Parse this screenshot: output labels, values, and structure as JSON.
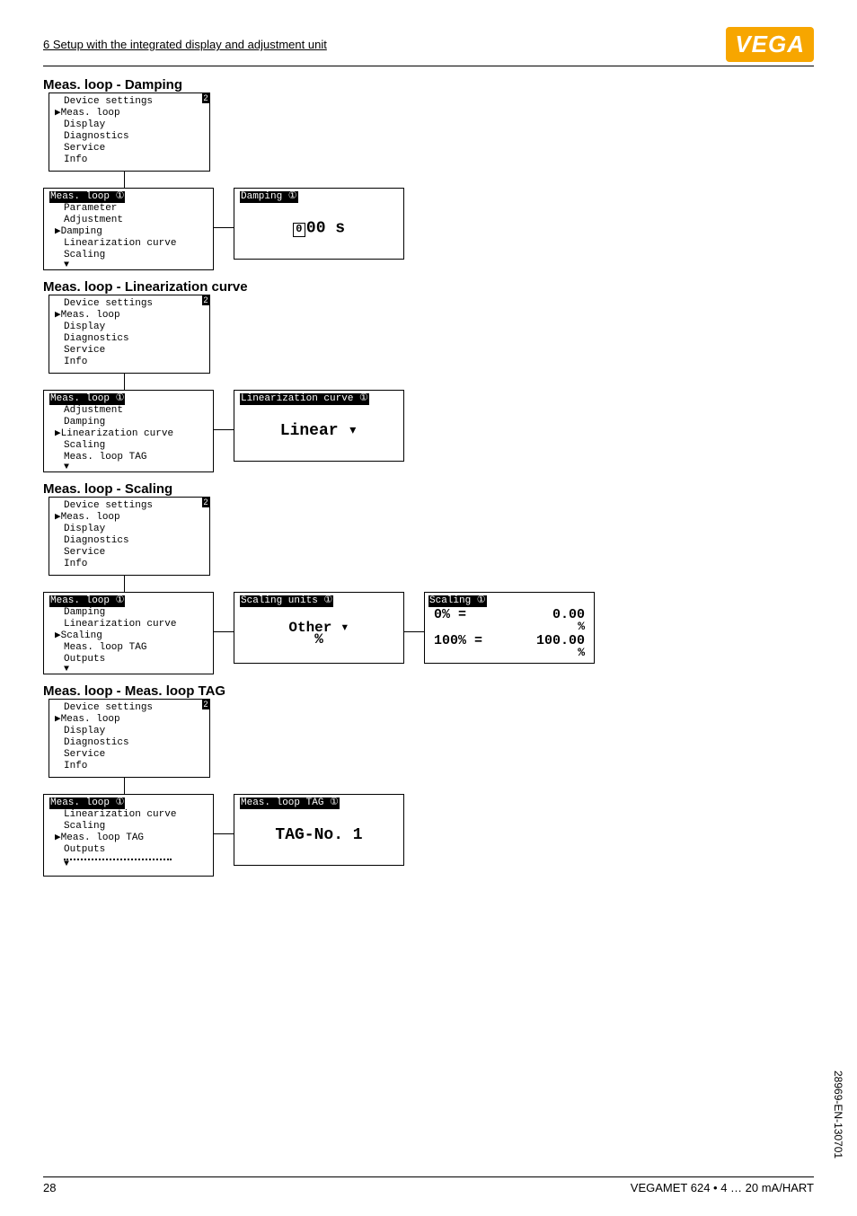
{
  "header": {
    "section_path": "6 Setup with the integrated display and adjustment unit",
    "logo": "VEGA"
  },
  "sections": {
    "damping": {
      "title": "Meas. loop - Damping",
      "top_menu": [
        "Device settings",
        "▶Meas. loop",
        "Display",
        "Diagnostics",
        "Service",
        "Info"
      ],
      "left": {
        "header": "Meas. loop ①",
        "items": [
          "Parameter",
          "Adjustment",
          "▶Damping",
          "Linearization curve",
          "Scaling"
        ]
      },
      "right": {
        "header": "Damping ①",
        "value_prefix": "0",
        "value_suffix": "00 s"
      }
    },
    "lin": {
      "title": "Meas. loop - Linearization curve",
      "top_menu": [
        "Device settings",
        "▶Meas. loop",
        "Display",
        "Diagnostics",
        "Service",
        "Info"
      ],
      "left": {
        "header": "Meas. loop ①",
        "items": [
          "Adjustment",
          "Damping",
          "▶Linearization curve",
          "Scaling",
          "Meas. loop TAG"
        ]
      },
      "right": {
        "header": "Linearization curve ①",
        "value": "Linear ▾"
      }
    },
    "scaling": {
      "title": "Meas. loop - Scaling",
      "top_menu": [
        "Device settings",
        "▶Meas. loop",
        "Display",
        "Diagnostics",
        "Service",
        "Info"
      ],
      "left": {
        "header": "Meas. loop ①",
        "items": [
          "Damping",
          "Linearization curve",
          "▶Scaling",
          "Meas. loop TAG",
          "Outputs"
        ]
      },
      "mid": {
        "header": "Scaling units ①",
        "line1": "Other ▾",
        "line2": "%"
      },
      "right": {
        "header": "Scaling ①",
        "row1_l": "0% =",
        "row1_r": "0.00",
        "row1_u": "%",
        "row2_l": "100% =",
        "row2_r": "100.00",
        "row2_u": "%"
      }
    },
    "tag": {
      "title": "Meas. loop - Meas. loop TAG",
      "top_menu": [
        "Device settings",
        "▶Meas. loop",
        "Display",
        "Diagnostics",
        "Service",
        "Info"
      ],
      "left": {
        "header": "Meas. loop ①",
        "items": [
          "Linearization curve",
          "Scaling",
          "▶Meas. loop TAG",
          "Outputs"
        ]
      },
      "right": {
        "header": "Meas. loop TAG ①",
        "value": "TAG-No. 1"
      }
    }
  },
  "footer": {
    "page": "28",
    "product": "VEGAMET 624 • 4 … 20 mA/HART"
  },
  "side_code": "28969-EN-130701"
}
